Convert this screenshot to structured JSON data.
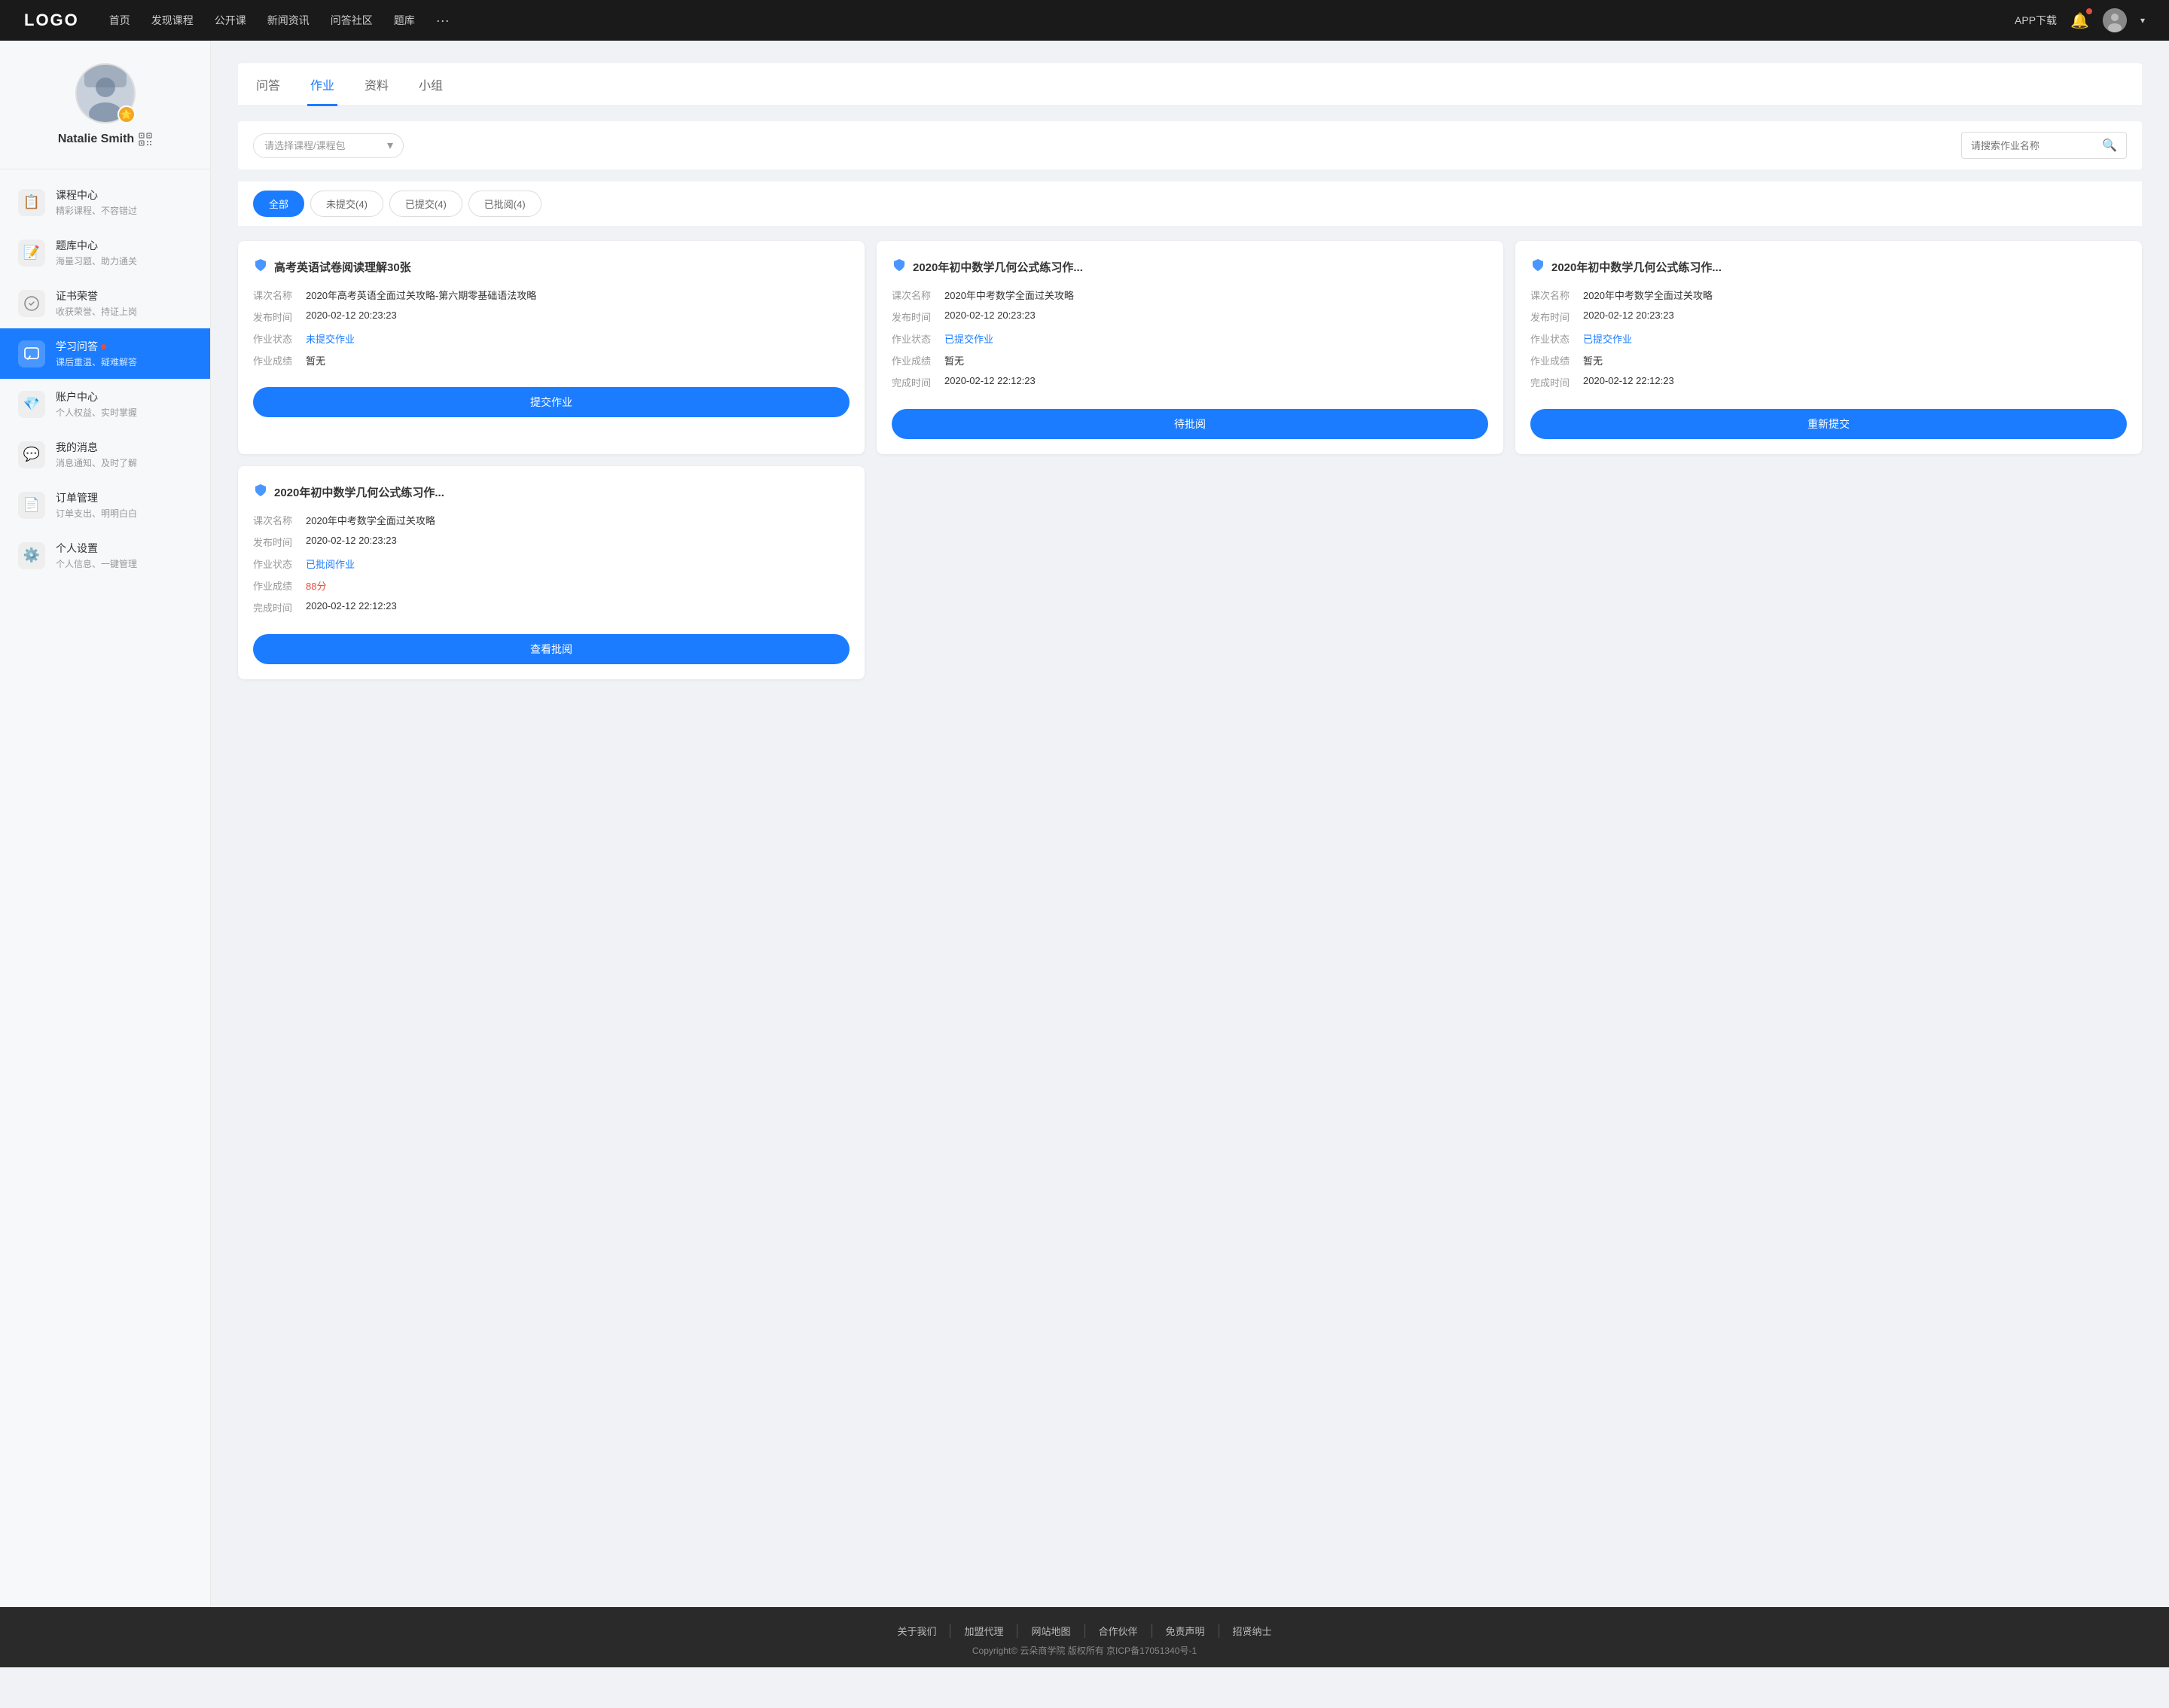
{
  "nav": {
    "logo": "LOGO",
    "links": [
      "首页",
      "发现课程",
      "公开课",
      "新闻资讯",
      "问答社区",
      "题库"
    ],
    "more": "···",
    "app_download": "APP下载"
  },
  "sidebar": {
    "profile": {
      "name": "Natalie Smith"
    },
    "menu": [
      {
        "id": "course-center",
        "title": "课程中心",
        "subtitle": "精彩课程、不容错过",
        "icon": "📋"
      },
      {
        "id": "question-bank",
        "title": "题库中心",
        "subtitle": "海量习题、助力通关",
        "icon": "📝"
      },
      {
        "id": "certificate",
        "title": "证书荣誉",
        "subtitle": "收获荣誉、持证上岗",
        "icon": "🏆"
      },
      {
        "id": "qa",
        "title": "学习问答",
        "subtitle": "课后重温、疑难解答",
        "icon": "💬",
        "badge": true,
        "active": true
      },
      {
        "id": "account",
        "title": "账户中心",
        "subtitle": "个人权益、实时掌握",
        "icon": "💎"
      },
      {
        "id": "messages",
        "title": "我的消息",
        "subtitle": "消息通知、及时了解",
        "icon": "💬"
      },
      {
        "id": "orders",
        "title": "订单管理",
        "subtitle": "订单支出、明明白白",
        "icon": "📄"
      },
      {
        "id": "settings",
        "title": "个人设置",
        "subtitle": "个人信息、一键管理",
        "icon": "⚙️"
      }
    ]
  },
  "content": {
    "tabs": [
      {
        "id": "qa",
        "label": "问答"
      },
      {
        "id": "homework",
        "label": "作业",
        "active": true
      },
      {
        "id": "materials",
        "label": "资料"
      },
      {
        "id": "groups",
        "label": "小组"
      }
    ],
    "filter": {
      "course_placeholder": "请选择课程/课程包",
      "search_placeholder": "请搜索作业名称"
    },
    "status_buttons": [
      {
        "id": "all",
        "label": "全部",
        "active": true
      },
      {
        "id": "not-submitted",
        "label": "未提交(4)"
      },
      {
        "id": "submitted",
        "label": "已提交(4)"
      },
      {
        "id": "reviewed",
        "label": "已批阅(4)"
      }
    ],
    "cards": [
      {
        "id": "card-1",
        "title": "高考英语试卷阅读理解30张",
        "fields": [
          {
            "label": "课次名称",
            "value": "2020年高考英语全面过关攻略-第六期零基础语法攻略"
          },
          {
            "label": "发布时间",
            "value": "2020-02-12 20:23:23"
          },
          {
            "label": "作业状态",
            "value": "未提交作业",
            "status": "not-submitted"
          },
          {
            "label": "作业成绩",
            "value": "暂无"
          }
        ],
        "button": "提交作业",
        "button_type": "primary"
      },
      {
        "id": "card-2",
        "title": "2020年初中数学几何公式练习作...",
        "fields": [
          {
            "label": "课次名称",
            "value": "2020年中考数学全面过关攻略"
          },
          {
            "label": "发布时间",
            "value": "2020-02-12 20:23:23"
          },
          {
            "label": "作业状态",
            "value": "已提交作业",
            "status": "submitted"
          },
          {
            "label": "作业成绩",
            "value": "暂无"
          },
          {
            "label": "完成时间",
            "value": "2020-02-12 22:12:23"
          }
        ],
        "button": "待批阅",
        "button_type": "primary"
      },
      {
        "id": "card-3",
        "title": "2020年初中数学几何公式练习作...",
        "fields": [
          {
            "label": "课次名称",
            "value": "2020年中考数学全面过关攻略"
          },
          {
            "label": "发布时间",
            "value": "2020-02-12 20:23:23"
          },
          {
            "label": "作业状态",
            "value": "已提交作业",
            "status": "submitted"
          },
          {
            "label": "作业成绩",
            "value": "暂无"
          },
          {
            "label": "完成时间",
            "value": "2020-02-12 22:12:23"
          }
        ],
        "button": "重新提交",
        "button_type": "primary"
      },
      {
        "id": "card-4",
        "title": "2020年初中数学几何公式练习作...",
        "fields": [
          {
            "label": "课次名称",
            "value": "2020年中考数学全面过关攻略"
          },
          {
            "label": "发布时间",
            "value": "2020-02-12 20:23:23"
          },
          {
            "label": "作业状态",
            "value": "已批阅作业",
            "status": "reviewed"
          },
          {
            "label": "作业成绩",
            "value": "88分",
            "score": true
          },
          {
            "label": "完成时间",
            "value": "2020-02-12 22:12:23"
          }
        ],
        "button": "查看批阅",
        "button_type": "primary"
      }
    ]
  },
  "footer": {
    "links": [
      "关于我们",
      "加盟代理",
      "网站地图",
      "合作伙伴",
      "免责声明",
      "招贤纳士"
    ],
    "copyright": "Copyright© 云朵商学院  版权所有    京ICP备17051340号-1"
  }
}
